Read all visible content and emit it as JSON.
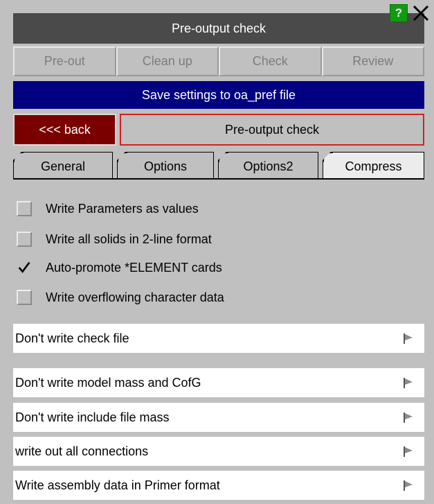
{
  "window": {
    "title": "Pre-output check",
    "help_label": "?",
    "close_icon": "close-icon"
  },
  "mode_buttons": [
    {
      "label": "Pre-out"
    },
    {
      "label": "Clean up"
    },
    {
      "label": "Check"
    },
    {
      "label": "Review"
    }
  ],
  "save_button": {
    "label": "Save settings to oa_pref file"
  },
  "back_button": {
    "label": "<<< back"
  },
  "panel_title": "Pre-output check",
  "tabs": [
    {
      "label": "General"
    },
    {
      "label": "Options"
    },
    {
      "label": "Options2",
      "active": true
    },
    {
      "label": "Compress"
    }
  ],
  "checkboxes": [
    {
      "label": "Write Parameters as values",
      "checked": false
    },
    {
      "label": "Write all solids in 2-line format",
      "checked": false
    },
    {
      "label": "Auto-promote *ELEMENT cards",
      "checked": true
    },
    {
      "label": "Write overflowing character data",
      "checked": false
    }
  ],
  "options": [
    {
      "label": "Don't write check file",
      "icon": "flag-arrow-icon"
    },
    {
      "label": "Don't write model mass and CofG",
      "icon": "flag-arrow-icon"
    },
    {
      "label": "Don't write include file mass",
      "icon": "flag-arrow-icon"
    },
    {
      "label": "write out all connections",
      "icon": "flag-arrow-icon"
    },
    {
      "label": "Write assembly data in Primer format",
      "icon": "flag-arrow-icon"
    }
  ],
  "colors": {
    "background": "#c0c0c0",
    "title_bar": "#4a4a4a",
    "save_button": "#000080",
    "back_button": "#7a0000",
    "panel_border": "#d42020",
    "help_button": "#119b11"
  }
}
